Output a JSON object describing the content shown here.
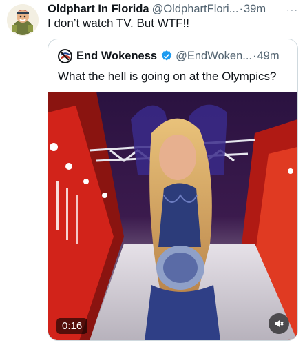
{
  "tweet": {
    "author_name": "Oldphart In Florida",
    "author_handle": "@OldphartFlori...",
    "separator": "·",
    "time": "39m",
    "more_label": "···",
    "text": "I don’t watch TV. But WTF!!"
  },
  "quoted": {
    "author_name": "End Wokeness",
    "author_handle": "@EndWoken...",
    "separator": "·",
    "time": "49m",
    "text": "What the hell is going on at the Olympics?",
    "video": {
      "duration": "0:16",
      "mute_icon": "speaker-muted-icon"
    }
  },
  "colors": {
    "secondary_text": "#536471",
    "verified": "#1d9bf0",
    "border": "#cfd9de"
  }
}
